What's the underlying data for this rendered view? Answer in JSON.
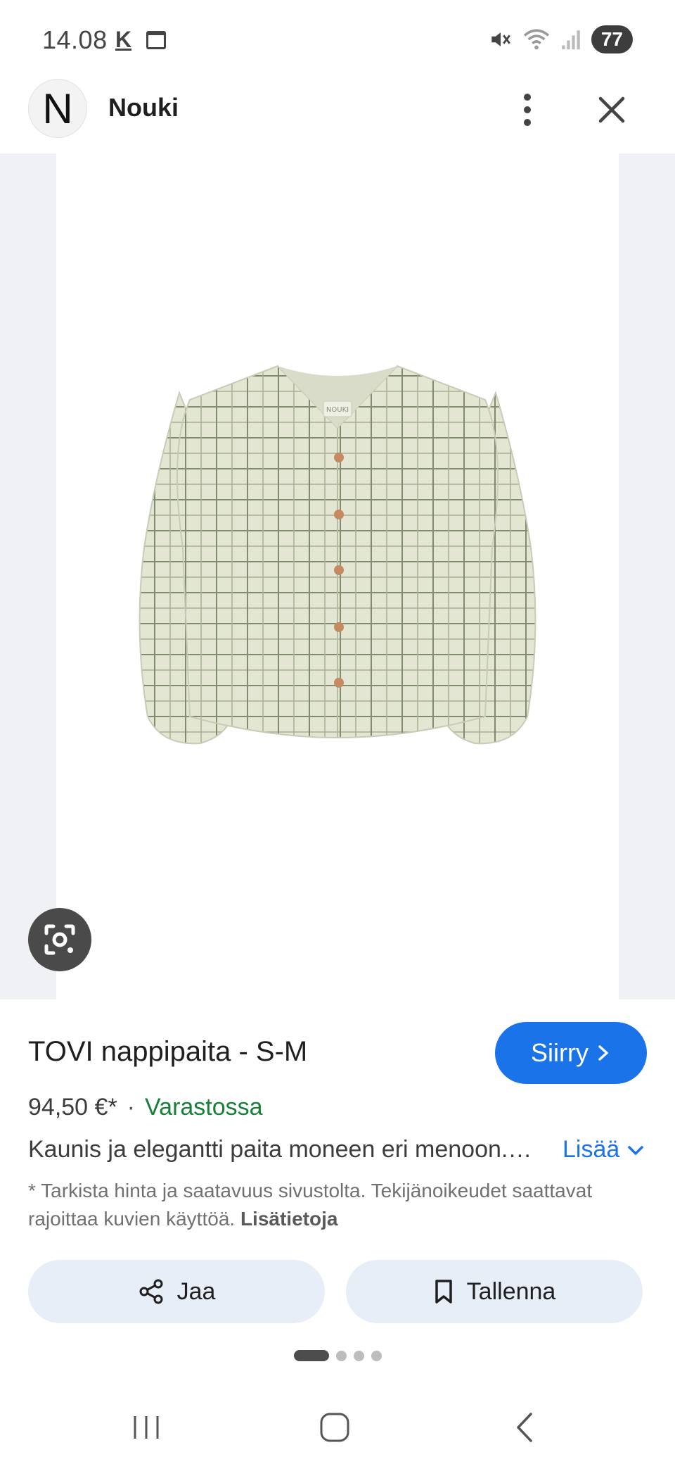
{
  "status_bar": {
    "time": "14.08",
    "k_icon": "K",
    "battery": "77",
    "icons": [
      "calendar-icon",
      "mute-icon",
      "wifi-icon",
      "signal-icon"
    ]
  },
  "header": {
    "logo_letter": "N",
    "site_name": "Nouki"
  },
  "product": {
    "title": "TOVI nappipaita - S-M",
    "visit_label": "Siirry",
    "price": "94,50 €*",
    "separator": "·",
    "stock": "Varastossa",
    "description": "Kaunis ja elegantti paita moneen eri menoon.…",
    "more_label": "Lisää",
    "disclaimer": "* Tarkista hinta ja saatavuus sivustolta. Tekijänoikeudet saattavat rajoittaa kuvien käyttöä.",
    "disclaimer_link": "Lisätietoja",
    "image_label": "NOUKI"
  },
  "actions": {
    "share_label": "Jaa",
    "save_label": "Tallenna"
  },
  "pager": {
    "total": 4,
    "active": 1
  },
  "colors": {
    "accent": "#1a73e8",
    "stock": "#188038",
    "action_bg": "#e8eef8"
  }
}
